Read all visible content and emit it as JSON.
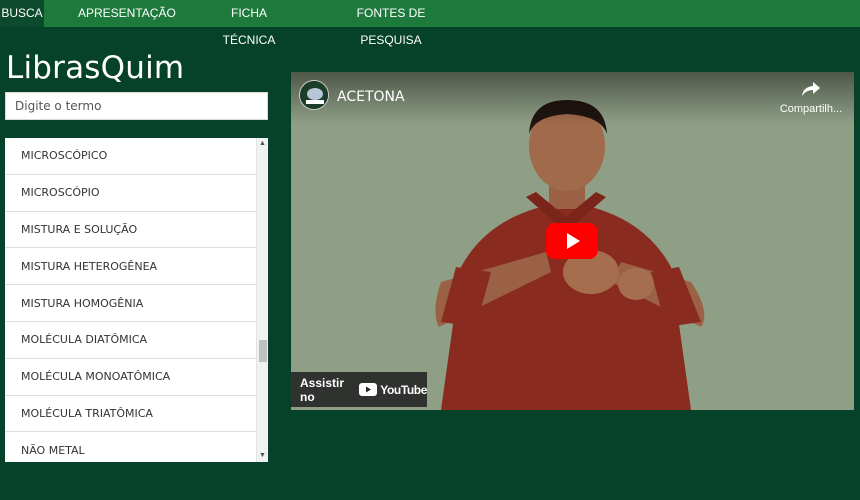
{
  "nav": {
    "items": [
      {
        "label": "BUSCA",
        "active": true
      },
      {
        "label": "APRESENTAÇÃO",
        "active": false
      },
      {
        "label": "FICHA TÉCNICA",
        "active": false
      },
      {
        "label": "FONTES DE PESQUISA",
        "active": false
      }
    ]
  },
  "brand": {
    "title": "LibrasQuim"
  },
  "search": {
    "placeholder": "Digite o termo"
  },
  "terms": [
    "MICROSCÓPICO",
    "MICROSCÓPIO",
    "MISTURA E SOLUÇÃO",
    "MISTURA HETEROGÊNEA",
    "MISTURA HOMOGÊNIA",
    "MOLÉCULA DIATÔMICA",
    "MOLÉCULA MONOATÔMICA",
    "MOLÉCULA TRIATÔMICA",
    "NÃO METAL"
  ],
  "video": {
    "title": "ACETONA",
    "share_label": "Compartilh...",
    "watch_on_label": "Assistir no",
    "platform_name": "YouTube"
  },
  "colors": {
    "page_bg": "#06422a",
    "nav_bg": "#1e7a3c",
    "nav_active_bg": "#0b4a2c",
    "play_red": "#ff0000"
  },
  "icons": {
    "share": "share-arrow-icon",
    "play": "play-button-icon",
    "youtube": "youtube-logo-icon",
    "scroll_up": "scroll-up-arrow-icon",
    "scroll_down": "scroll-down-arrow-icon"
  }
}
